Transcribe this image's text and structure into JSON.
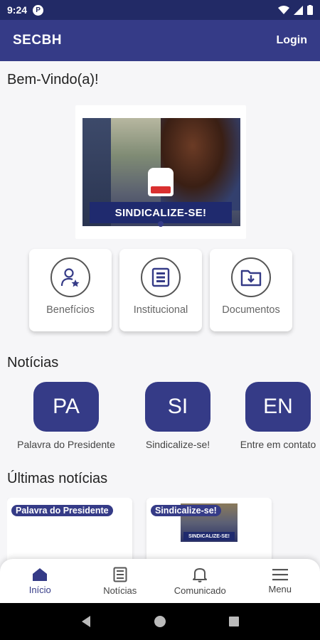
{
  "status_bar": {
    "time": "9:24",
    "notification_badge": "P"
  },
  "app_bar": {
    "title": "SECBH",
    "login_label": "Login"
  },
  "welcome": "Bem-Vindo(a)!",
  "banner": {
    "text": "SINDICALIZE-SE!"
  },
  "shortcuts": [
    {
      "label": "Benefícios",
      "icon": "user-star-icon"
    },
    {
      "label": "Institucional",
      "icon": "document-list-icon"
    },
    {
      "label": "Documentos",
      "icon": "folder-download-icon"
    }
  ],
  "news_section_title": "Notícias",
  "stories": [
    {
      "initials": "PA",
      "caption": "Palavra do Presidente"
    },
    {
      "initials": "SI",
      "caption": "Sindicalize-se!"
    },
    {
      "initials": "EN",
      "caption": "Entre em contato"
    }
  ],
  "latest_section_title": "Últimas notícias",
  "latest_news": [
    {
      "tag": "Palavra do Presidente"
    },
    {
      "tag": "Sindicalize-se!",
      "thumb_text": "SINDICALIZE-SE!"
    }
  ],
  "bottom_nav": [
    {
      "label": "Início",
      "icon": "home-icon",
      "active": true
    },
    {
      "label": "Notícias",
      "icon": "news-icon",
      "active": false
    },
    {
      "label": "Comunicado",
      "icon": "bell-icon",
      "active": false
    },
    {
      "label": "Menu",
      "icon": "hamburger-menu-icon",
      "active": false
    }
  ],
  "colors": {
    "primary": "#353b87",
    "status_bar": "#222a66",
    "background": "#f6f6f8"
  }
}
